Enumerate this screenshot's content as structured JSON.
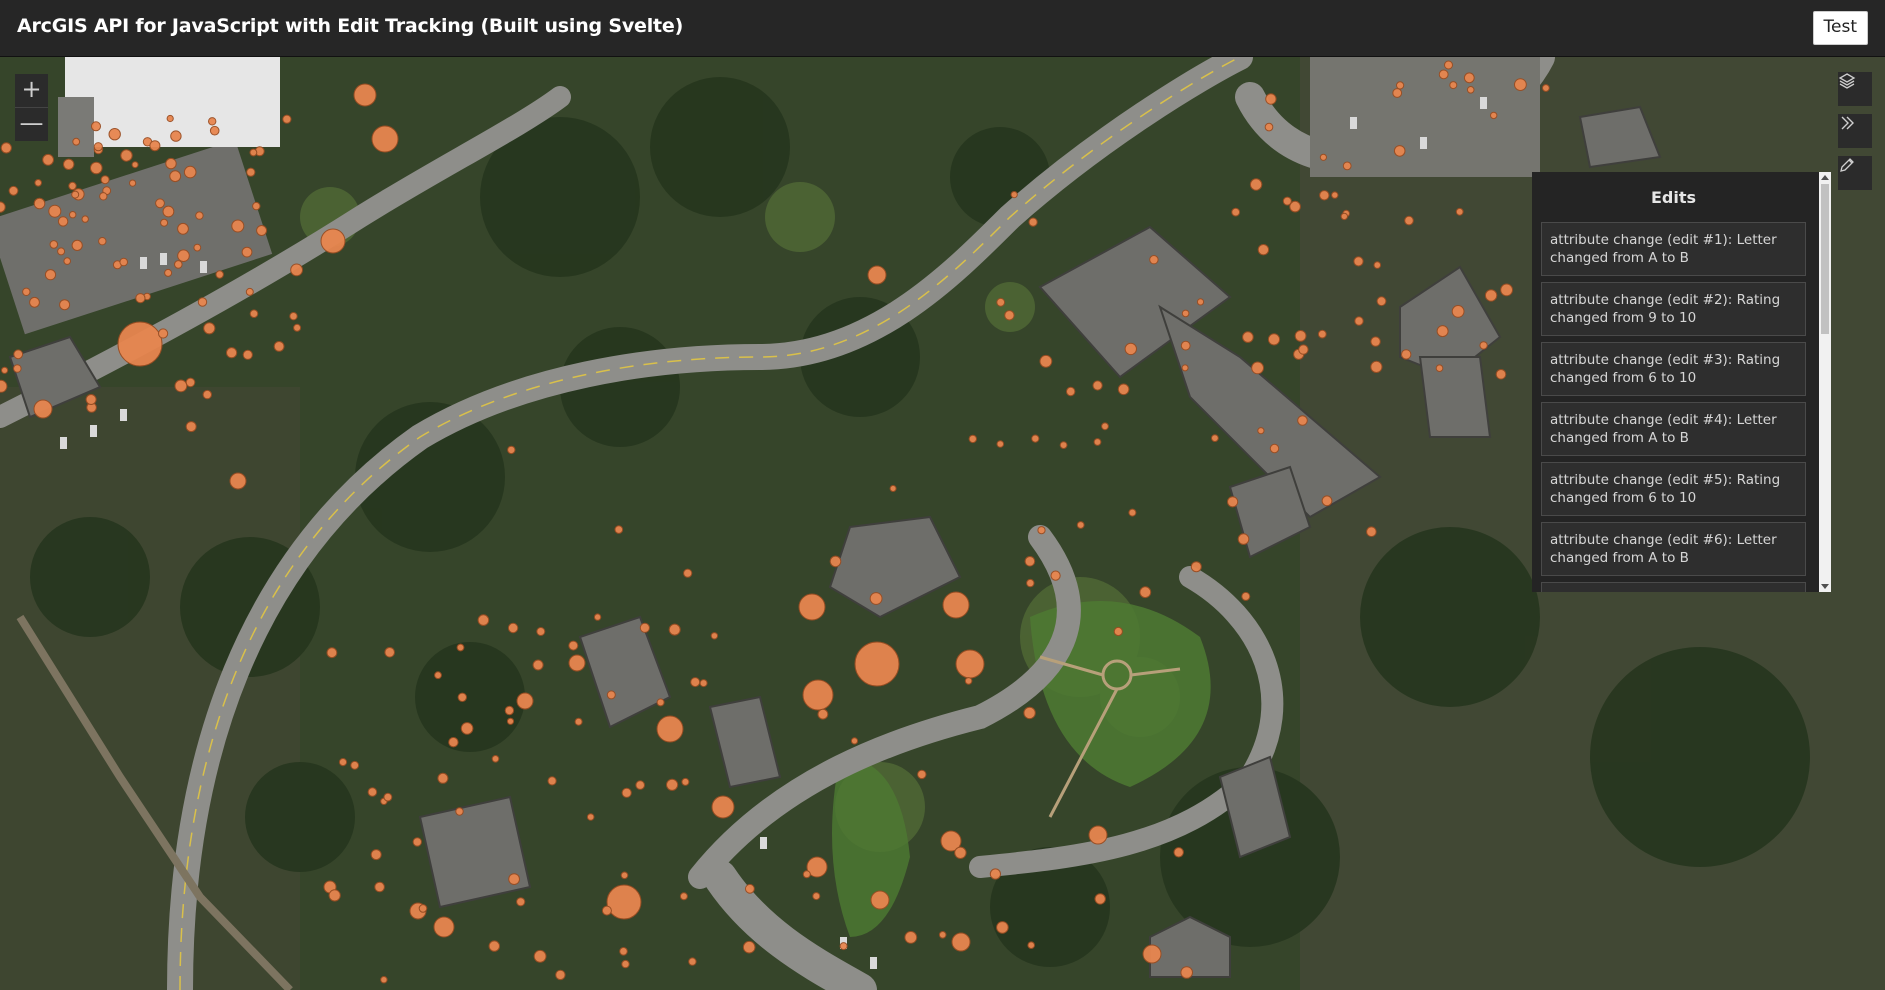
{
  "header": {
    "title": "ArcGIS API for JavaScript with Edit Tracking (Built using Svelte)",
    "test_button": "Test"
  },
  "map": {
    "zoom_in": "+",
    "zoom_out": "—",
    "marker_color": "#e8864f",
    "tools": [
      "layers-icon",
      "chevrons-right-icon",
      "pencil-icon"
    ]
  },
  "edits": {
    "title": "Edits",
    "items": [
      "attribute change (edit #1): Letter changed from A to B",
      "attribute change (edit #2): Rating changed from 9 to 10",
      "attribute change (edit #3): Rating changed from 6 to 10",
      "attribute change (edit #4): Letter changed from A to B",
      "attribute change (edit #5): Rating changed from 6 to 10",
      "attribute change (edit #6): Letter changed from A to B"
    ]
  }
}
